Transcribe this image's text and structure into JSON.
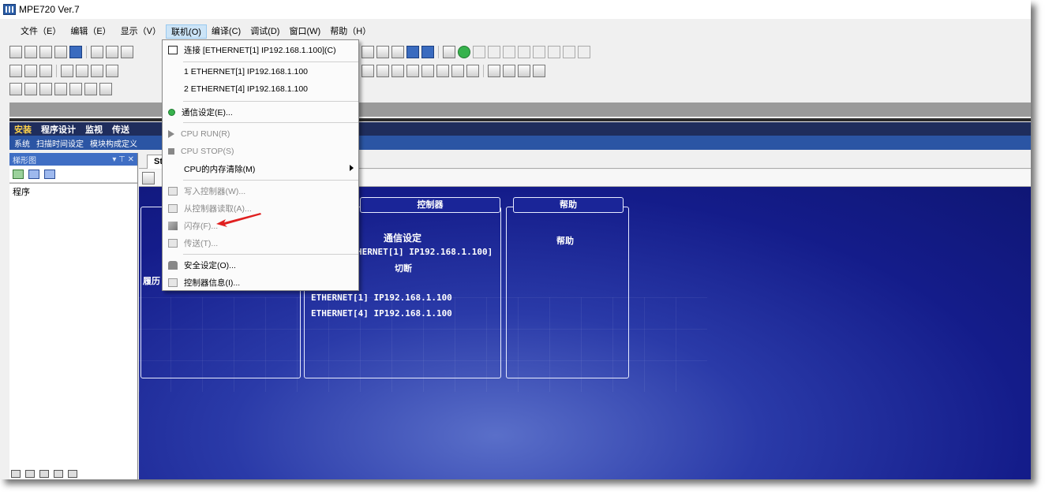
{
  "window": {
    "title": "MPE720 Ver.7"
  },
  "menubar": {
    "items": [
      "文件（E）",
      "编辑（E）",
      "显示（V）",
      "联机(O)",
      "编译(C)",
      "调试(D)",
      "窗口(W)",
      "帮助（H）"
    ],
    "active_index": 3
  },
  "app_tabs": {
    "items": [
      "安装",
      "程序设计",
      "监视",
      "传送"
    ],
    "active_index": 0
  },
  "sub_tabs": {
    "items": [
      "系统",
      "扫描时间设定",
      "模块构成定义"
    ]
  },
  "left_panel": {
    "header": "梯形图",
    "tree_root": "程序"
  },
  "doc_tab": {
    "label": "St"
  },
  "canvas": {
    "panel_controller": {
      "title": "控制器",
      "comm_setting": "通信设定",
      "current_connection": "HERNET[1] IP192.168.1.100]",
      "disconnect": "切断",
      "history": [
        "ETHERNET[1] IP192.168.1.100",
        "ETHERNET[4] IP192.168.1.100"
      ]
    },
    "panel_help": {
      "title": "帮助",
      "text": "帮助"
    },
    "panel_left": {
      "partial_text": "履历"
    }
  },
  "dropdown": {
    "connect": "连接 [ETHERNET[1] IP192.168.1.100](C)",
    "recent_1": "1 ETHERNET[1] IP192.168.1.100",
    "recent_2": "2 ETHERNET[4] IP192.168.1.100",
    "comm_setting": "通信设定(E)...",
    "cpu_run": "CPU RUN(R)",
    "cpu_stop": "CPU STOP(S)",
    "cpu_clear": "CPU的内存清除(M)",
    "write": "写入控制器(W)...",
    "read": "从控制器读取(A)...",
    "flash": "闪存(F)...",
    "transfer": "传送(T)...",
    "security": "安全设定(O)...",
    "info": "控制器信息(I)..."
  },
  "colors": {
    "canvas_blue": "#141c8a",
    "annotation_arrow": "#e02020",
    "menu_highlight": "#cce4f7"
  }
}
